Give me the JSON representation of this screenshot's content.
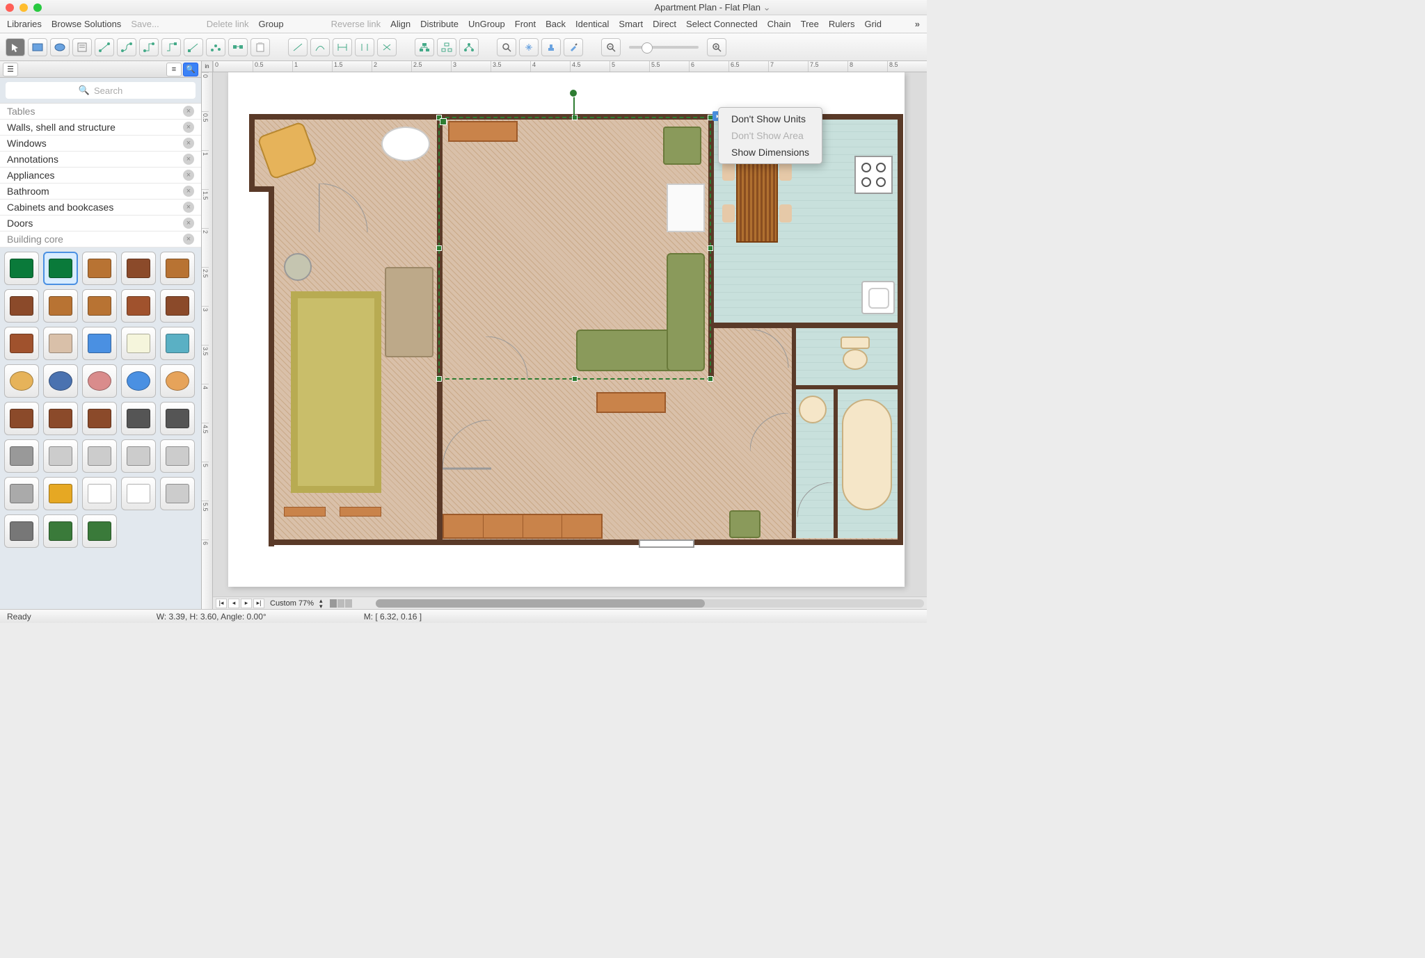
{
  "title": "Apartment Plan - Flat Plan",
  "menu": [
    "Libraries",
    "Browse Solutions",
    "Save...",
    "Delete link",
    "Group",
    "Reverse link",
    "Align",
    "Distribute",
    "UnGroup",
    "Front",
    "Back",
    "Identical",
    "Smart",
    "Direct",
    "Select Connected",
    "Chain",
    "Tree",
    "Rulers",
    "Grid"
  ],
  "menu_dim": [
    2,
    3,
    5
  ],
  "search_placeholder": "Search",
  "categories": [
    "Tables",
    "Walls, shell and structure",
    "Windows",
    "Annotations",
    "Appliances",
    "Bathroom",
    "Cabinets and bookcases",
    "Doors",
    "Building core"
  ],
  "ruler_unit": "in",
  "ruler_h": [
    "0",
    "0.5",
    "1",
    "1.5",
    "2",
    "2.5",
    "3",
    "3.5",
    "4",
    "4.5",
    "5",
    "5.5",
    "6",
    "6.5",
    "7",
    "7.5",
    "8",
    "8.5"
  ],
  "ruler_v": [
    "0",
    "0.5",
    "1",
    "1.5",
    "2",
    "2.5",
    "3",
    "3.5",
    "4",
    "4.5",
    "5",
    "5.5",
    "6"
  ],
  "context_menu": {
    "items": [
      "Don't Show Units",
      "Don't Show Area",
      "Show Dimensions"
    ],
    "dim": [
      1
    ]
  },
  "zoom_label": "Custom 77%",
  "status": {
    "ready": "Ready",
    "dims": "W: 3.39,  H: 3.60,  Angle: 0.00°",
    "mouse": "M: [ 6.32, 0.16 ]"
  },
  "shape_colors": [
    "#0a7a3a",
    "#0a7a3a",
    "#b87333",
    "#8b4a2a",
    "#b87333",
    "#8b4a2a",
    "#b87333",
    "#b87333",
    "#a0522d",
    "#8b4a2a",
    "#a0522d",
    "#d9c0a9",
    "#4a90e2",
    "#f5f5dc",
    "#5ab0c4",
    "#e6b35a",
    "#4a72b0",
    "#d98c8c",
    "#4a90e2",
    "#e6a35a",
    "#8b4a2a",
    "#8b4a2a",
    "#8b4a2a",
    "#555",
    "#555",
    "#999",
    "#ccc",
    "#ccc",
    "#ccc",
    "#ccc",
    "#aaa",
    "#e6a823",
    "#fff",
    "#fff",
    "#ccc",
    "#777",
    "#3a7a3a",
    "#3a7a3a"
  ]
}
